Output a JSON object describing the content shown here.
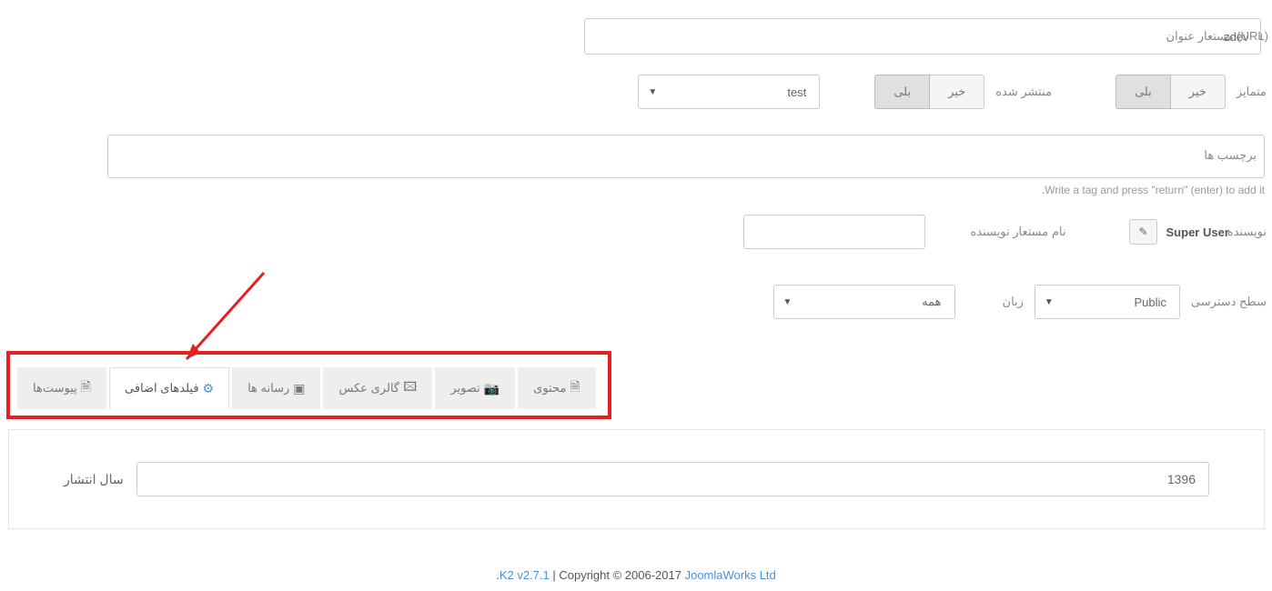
{
  "title_alias": {
    "label": "مستعار عنوان (URL)",
    "value": "zdev"
  },
  "featured": {
    "label": "متمایز",
    "yes": "بلی",
    "no": "خیر"
  },
  "published": {
    "label": "منتشر شده",
    "yes": "بلی",
    "no": "خیر"
  },
  "category": {
    "selected": "test"
  },
  "tags": {
    "label": "برچسب ها",
    "help": ".Write a tag and press \"return\" (enter) to add it"
  },
  "author": {
    "label": "نویسنده",
    "value": "Super User"
  },
  "author_alias": {
    "label": "نام مستعار نویسنده"
  },
  "access": {
    "label": "سطح دسترسی",
    "selected": "Public"
  },
  "language": {
    "label": "زبان",
    "selected": "همه"
  },
  "tabs": {
    "content": "محتوی",
    "image": "تصویر",
    "gallery": "گالری عکس",
    "media": "رسانه ها",
    "extra": "فیلدهای اضافی",
    "attach": "پیوست‌ها"
  },
  "year": {
    "label": "سال انتشار",
    "value": "1396"
  },
  "footer": {
    "k2": "K2 v2.7.1",
    "copy": " | Copyright © 2006-2017 ",
    "link": "JoomlaWorks Ltd",
    "dot": "."
  }
}
